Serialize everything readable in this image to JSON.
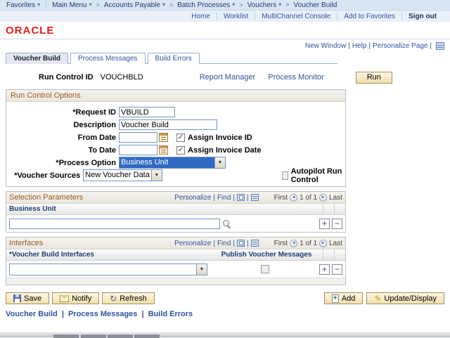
{
  "topbar": {
    "items": [
      "Favorites",
      "Main Menu",
      "Accounts Payable",
      "Batch Processes",
      "Vouchers",
      "Voucher Build"
    ]
  },
  "header_links": {
    "home": "Home",
    "worklist": "Worklist",
    "multichannel_console": "MultiChannel Console",
    "add_to_favorites": "Add to Favorites",
    "sign_out": "Sign out"
  },
  "brand": {
    "logo_text": "ORACLE"
  },
  "page_links": {
    "new_window": "New Window",
    "help": "Help",
    "personalize_page": "Personalize Page"
  },
  "tabs": [
    {
      "label": "Voucher Build",
      "active": true
    },
    {
      "label": "Process Messages",
      "active": false
    },
    {
      "label": "Build Errors",
      "active": false
    }
  ],
  "run_header": {
    "run_control_id_label": "Run Control ID",
    "run_control_id_value": "VOUCHBLD",
    "report_manager_link": "Report Manager",
    "process_monitor_link": "Process Monitor",
    "run_button_label": "Run"
  },
  "run_control_options": {
    "title": "Run Control Options",
    "request_id": {
      "label": "*Request ID",
      "value": "VBUILD"
    },
    "description": {
      "label": "Description",
      "value": "Voucher Build"
    },
    "from_date": {
      "label": "From Date",
      "value": ""
    },
    "to_date": {
      "label": "To Date",
      "value": ""
    },
    "assign_invoice_id": {
      "label": "Assign Invoice ID",
      "checked": true
    },
    "assign_invoice_date": {
      "label": "Assign Invoice Date",
      "checked": true
    },
    "process_option": {
      "label": "*Process Option",
      "value": "Business Unit"
    },
    "voucher_sources": {
      "label": "*Voucher Sources",
      "value": "New Voucher Data"
    },
    "autopilot": {
      "label": "Autopilot Run Control",
      "checked": false
    }
  },
  "selection_parameters": {
    "title": "Selection Parameters",
    "personalize_link": "Personalize",
    "find_link": "Find",
    "first_label": "First",
    "position_label": "1 of 1",
    "last_label": "Last",
    "column_header": "Business Unit",
    "business_unit_value": ""
  },
  "interfaces": {
    "title": "Interfaces",
    "personalize_link": "Personalize",
    "find_link": "Find",
    "first_label": "First",
    "position_label": "1 of 1",
    "last_label": "Last",
    "columns": [
      "*Voucher Build Interfaces",
      "Publish Voucher Messages"
    ],
    "interface_value": "",
    "publish_checked": false
  },
  "action_toolbar": {
    "save": "Save",
    "notify": "Notify",
    "refresh": "Refresh",
    "add": "Add",
    "update_display": "Update/Display"
  },
  "footer_links": [
    "Voucher Build",
    "Process Messages",
    "Build Errors"
  ],
  "icons": {
    "dropdown_arrow": "▾",
    "crumb_sep": ">",
    "select_arrow": "▼",
    "check": "✓",
    "plus": "+",
    "minus": "−",
    "first_arrow": "◄",
    "last_arrow": "►",
    "refresh": "↻",
    "pencil": "✎",
    "pipe": "|"
  },
  "colors": {
    "link_blue": "#2d52a0",
    "oracle_red": "#e21f1f",
    "section_title_brown": "#9c5a21",
    "selection_highlight": "#316ac5",
    "button_face": "#f6e7bc",
    "topbar_bg": "#d9e5f3"
  }
}
